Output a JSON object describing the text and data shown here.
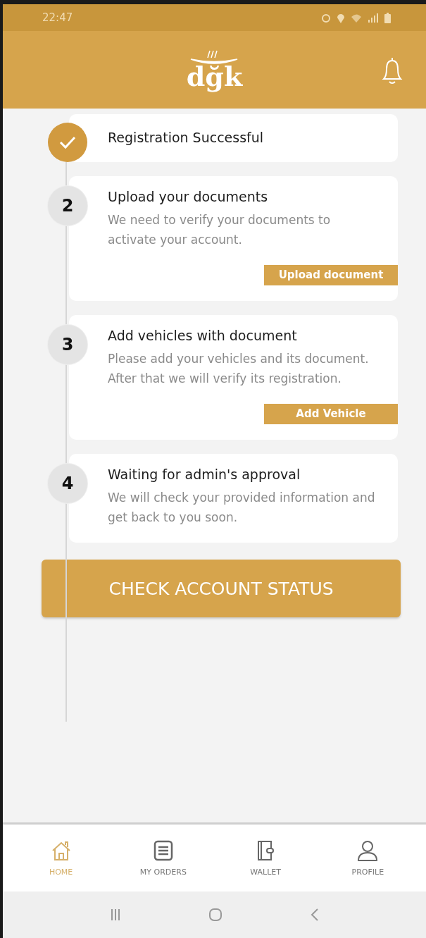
{
  "status_bar": {
    "time": "22:47"
  },
  "header": {
    "logo": "dğk"
  },
  "steps": [
    {
      "completed": true,
      "title": "Registration Successful"
    },
    {
      "completed": false,
      "number": "2",
      "title": "Upload your documents",
      "description": "We need to verify your documents to activate your account.",
      "action": "Upload document"
    },
    {
      "completed": false,
      "number": "3",
      "title": "Add vehicles with document",
      "description": "Please add your vehicles and its document. After that we will verify its registration.",
      "action": "Add Vehicle"
    },
    {
      "completed": false,
      "number": "4",
      "title": "Waiting for admin's approval",
      "description": "We will check your provided information and get back to you soon."
    }
  ],
  "primary_button": "CHECK ACCOUNT STATUS",
  "bottom_nav": [
    {
      "kind": "home",
      "label": "HOME",
      "selected": true
    },
    {
      "kind": "orders",
      "label": "MY ORDERS",
      "selected": false
    },
    {
      "kind": "wallet",
      "label": "WALLET",
      "selected": false
    },
    {
      "kind": "profile",
      "label": "PROFILE",
      "selected": false
    }
  ]
}
